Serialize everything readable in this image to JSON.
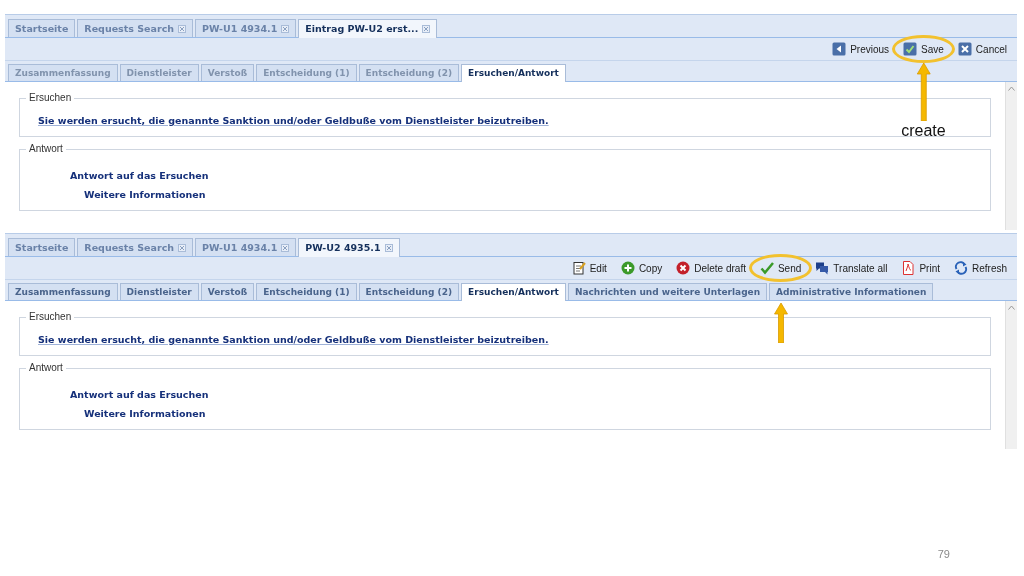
{
  "screens": [
    {
      "doc_tabs": [
        {
          "label": "Startseite",
          "closable": false,
          "selected": false
        },
        {
          "label": "Requests Search",
          "closable": true,
          "selected": false
        },
        {
          "label": "PW-U1 4934.1",
          "closable": true,
          "selected": false
        },
        {
          "label": "Eintrag PW-U2 erst...",
          "closable": true,
          "selected": true
        }
      ],
      "toolbar": [
        {
          "kind": "previous",
          "label": "Previous",
          "highlighted": false
        },
        {
          "kind": "save",
          "label": "Save",
          "highlighted": true,
          "callout": "create"
        },
        {
          "kind": "cancel",
          "label": "Cancel",
          "highlighted": false
        }
      ],
      "section_tabs": [
        {
          "label": "Zusammenfassung",
          "selected": false,
          "disabled": true
        },
        {
          "label": "Dienstleister",
          "selected": false,
          "disabled": true
        },
        {
          "label": "Verstoß",
          "selected": false,
          "disabled": true
        },
        {
          "label": "Entscheidung (1)",
          "selected": false,
          "disabled": true
        },
        {
          "label": "Entscheidung (2)",
          "selected": false,
          "disabled": true
        },
        {
          "label": "Ersuchen/Antwort",
          "selected": true,
          "disabled": false
        }
      ],
      "fieldsets": [
        {
          "legend": "Ersuchen",
          "lines": [
            {
              "kind": "link",
              "text": "Sie werden ersucht, die genannte Sanktion und/oder Geldbuße vom Dienstleister beizutreiben."
            }
          ]
        },
        {
          "legend": "Antwort",
          "lines": [
            {
              "kind": "heading",
              "text": "Antwort auf das Ersuchen"
            },
            {
              "kind": "subheading",
              "text": "Weitere Informationen"
            }
          ]
        }
      ]
    },
    {
      "doc_tabs": [
        {
          "label": "Startseite",
          "closable": false,
          "selected": false
        },
        {
          "label": "Requests Search",
          "closable": true,
          "selected": false
        },
        {
          "label": "PW-U1 4934.1",
          "closable": true,
          "selected": false
        },
        {
          "label": "PW-U2 4935.1",
          "closable": true,
          "selected": true
        }
      ],
      "toolbar": [
        {
          "kind": "edit",
          "label": "Edit",
          "highlighted": false
        },
        {
          "kind": "copy",
          "label": "Copy",
          "highlighted": false
        },
        {
          "kind": "delete",
          "label": "Delete draft",
          "highlighted": false
        },
        {
          "kind": "send",
          "label": "Send",
          "highlighted": true
        },
        {
          "kind": "translate",
          "label": "Translate all",
          "highlighted": false
        },
        {
          "kind": "print",
          "label": "Print",
          "highlighted": false
        },
        {
          "kind": "refresh",
          "label": "Refresh",
          "highlighted": false
        }
      ],
      "section_tabs": [
        {
          "label": "Zusammenfassung",
          "selected": false,
          "disabled": false
        },
        {
          "label": "Dienstleister",
          "selected": false,
          "disabled": false
        },
        {
          "label": "Verstoß",
          "selected": false,
          "disabled": false
        },
        {
          "label": "Entscheidung (1)",
          "selected": false,
          "disabled": false
        },
        {
          "label": "Entscheidung (2)",
          "selected": false,
          "disabled": false
        },
        {
          "label": "Ersuchen/Antwort",
          "selected": true,
          "disabled": false
        },
        {
          "label": "Nachrichten und weitere Unterlagen",
          "selected": false,
          "disabled": false
        },
        {
          "label": "Administrative Informationen",
          "selected": false,
          "disabled": false
        }
      ],
      "fieldsets": [
        {
          "legend": "Ersuchen",
          "lines": [
            {
              "kind": "link",
              "text": "Sie werden ersucht, die genannte Sanktion und/oder Geldbuße vom Dienstleister beizutreiben."
            }
          ]
        },
        {
          "legend": "Antwort",
          "lines": [
            {
              "kind": "heading",
              "text": "Antwort auf das Ersuchen"
            },
            {
              "kind": "subheading",
              "text": "Weitere Informationen"
            }
          ]
        }
      ]
    }
  ],
  "page_number": "79"
}
